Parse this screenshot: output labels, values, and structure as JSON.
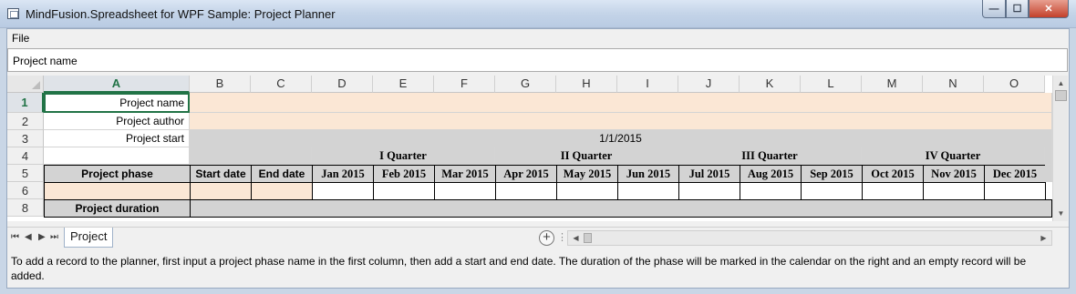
{
  "window": {
    "title": "MindFusion.Spreadsheet for WPF Sample: Project Planner",
    "minimize_glyph": "—",
    "maximize_glyph": "☐",
    "close_glyph": "✕"
  },
  "menu": {
    "file": "File"
  },
  "namebox": {
    "value": "Project name"
  },
  "grid": {
    "columns": [
      "A",
      "B",
      "C",
      "D",
      "E",
      "F",
      "G",
      "H",
      "I",
      "J",
      "K",
      "L",
      "M",
      "N",
      "O"
    ],
    "active_column": "A",
    "rows": [
      "1",
      "2",
      "3",
      "4",
      "5",
      "6",
      "8"
    ],
    "active_row": "1",
    "labels": {
      "project_name": "Project name",
      "project_author": "Project author",
      "project_start": "Project start",
      "project_phase": "Project phase",
      "project_duration": "Project duration"
    },
    "start_date_value": "1/1/2015",
    "quarters": [
      "I Quarter",
      "II Quarter",
      "III Quarter",
      "IV Quarter"
    ],
    "phase_headers": [
      "Start date",
      "End date"
    ],
    "months": [
      "Jan 2015",
      "Feb 2015",
      "Mar 2015",
      "Apr 2015",
      "May 2015",
      "Jun 2015",
      "Jul 2015",
      "Aug 2015",
      "Sep 2015",
      "Oct 2015",
      "Nov 2015",
      "Dec 2015"
    ]
  },
  "scroll": {
    "up": "▲",
    "down": "▼",
    "left": "◀",
    "right": "▶"
  },
  "tabs": {
    "nav_first": "⏮",
    "nav_prev": "◀",
    "nav_next": "▶",
    "nav_last": "⏭",
    "sheets": [
      "Project"
    ],
    "add_sheet": "+",
    "split_handle": "⋮"
  },
  "status_text": "To add a record to the planner, first input a project phase name in the first column, then add a start and end date. The duration of the phase will be marked in the calendar on the right and an empty record will be added.",
  "colors": {
    "accent": "#217346",
    "input_fill": "#fbe7d5",
    "header_fill": "#d3d3d3"
  }
}
